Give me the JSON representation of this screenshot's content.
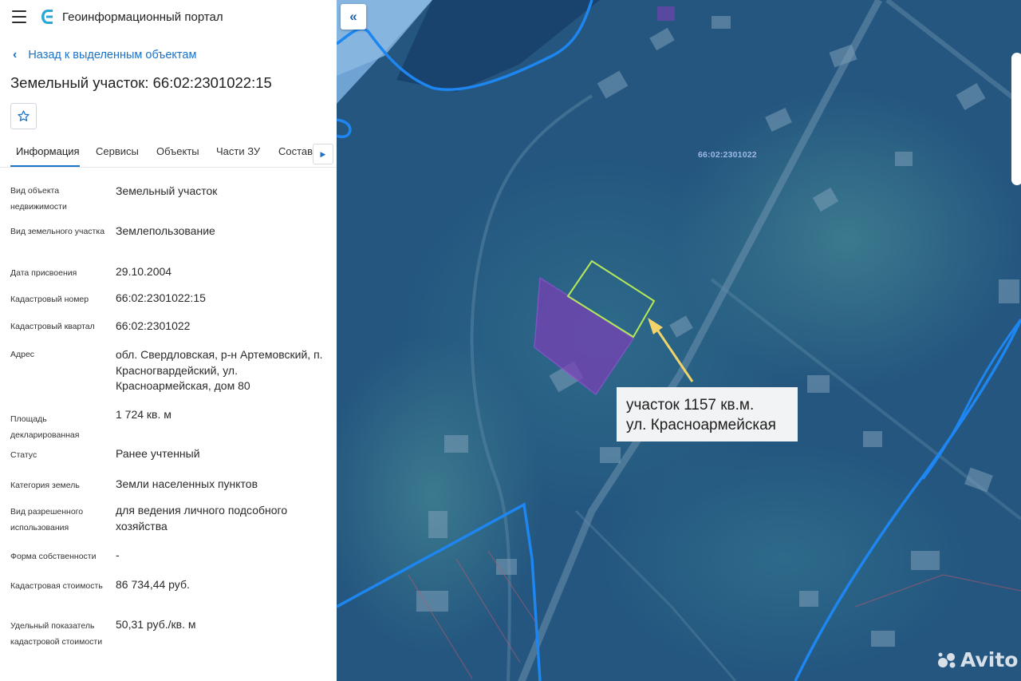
{
  "header": {
    "app_title": "Геоинформационный портал"
  },
  "nav": {
    "back_label": "Назад к выделенным объектам"
  },
  "object": {
    "title": "Земельный участок: 66:02:2301022:15"
  },
  "tabs": [
    {
      "label": "Информация",
      "active": true
    },
    {
      "label": "Сервисы"
    },
    {
      "label": "Объекты"
    },
    {
      "label": "Части ЗУ"
    },
    {
      "label": "Состав"
    }
  ],
  "attributes": [
    {
      "label": "Вид объекта недвижимости",
      "value": "Земельный участок"
    },
    {
      "label": "Вид земельного участка",
      "value": "Землепользование"
    },
    {
      "label": "Дата присвоения",
      "value": "29.10.2004"
    },
    {
      "label": "Кадастровый номер",
      "value": "66:02:2301022:15"
    },
    {
      "label": "Кадастровый квартал",
      "value": "66:02:2301022"
    },
    {
      "label": "Адрес",
      "value": "обл. Свердловская, р-н Артемовский, п. Красногвардейский, ул. Красноармейская, дом 80"
    },
    {
      "label": "Площадь декларированная",
      "value": "1 724 кв. м"
    },
    {
      "label": "Статус",
      "value": "Ранее учтенный"
    },
    {
      "label": "Категория земель",
      "value": "Земли населенных пунктов"
    },
    {
      "label": "Вид разрешенного использования",
      "value": "для ведения личного подсобного хозяйства"
    },
    {
      "label": "Форма собственности",
      "value": "-"
    },
    {
      "label": "Кадастровая стоимость",
      "value": "86 734,44 руб."
    },
    {
      "label": "Удельный показатель кадастровой стоимости",
      "value": "50,31 руб./кв. м"
    }
  ],
  "map": {
    "quarter_label": "66:02:2301022",
    "callout_line1": "участок 1157 кв.м.",
    "callout_line2": "ул. Красноармейская",
    "watermark": "Avito",
    "colors": {
      "boundary": "#1e86f0",
      "parcel_highlight": "#7b3fb6",
      "plot_outline": "#b6e85a",
      "arrow": "#f1d36a"
    }
  },
  "icons": {
    "menu": "menu-icon",
    "logo": "portal-logo-icon",
    "back": "chevron-left-icon",
    "favorite": "star-icon",
    "tab_scroll": "caret-right-icon",
    "collapse": "double-chevron-left-icon"
  }
}
